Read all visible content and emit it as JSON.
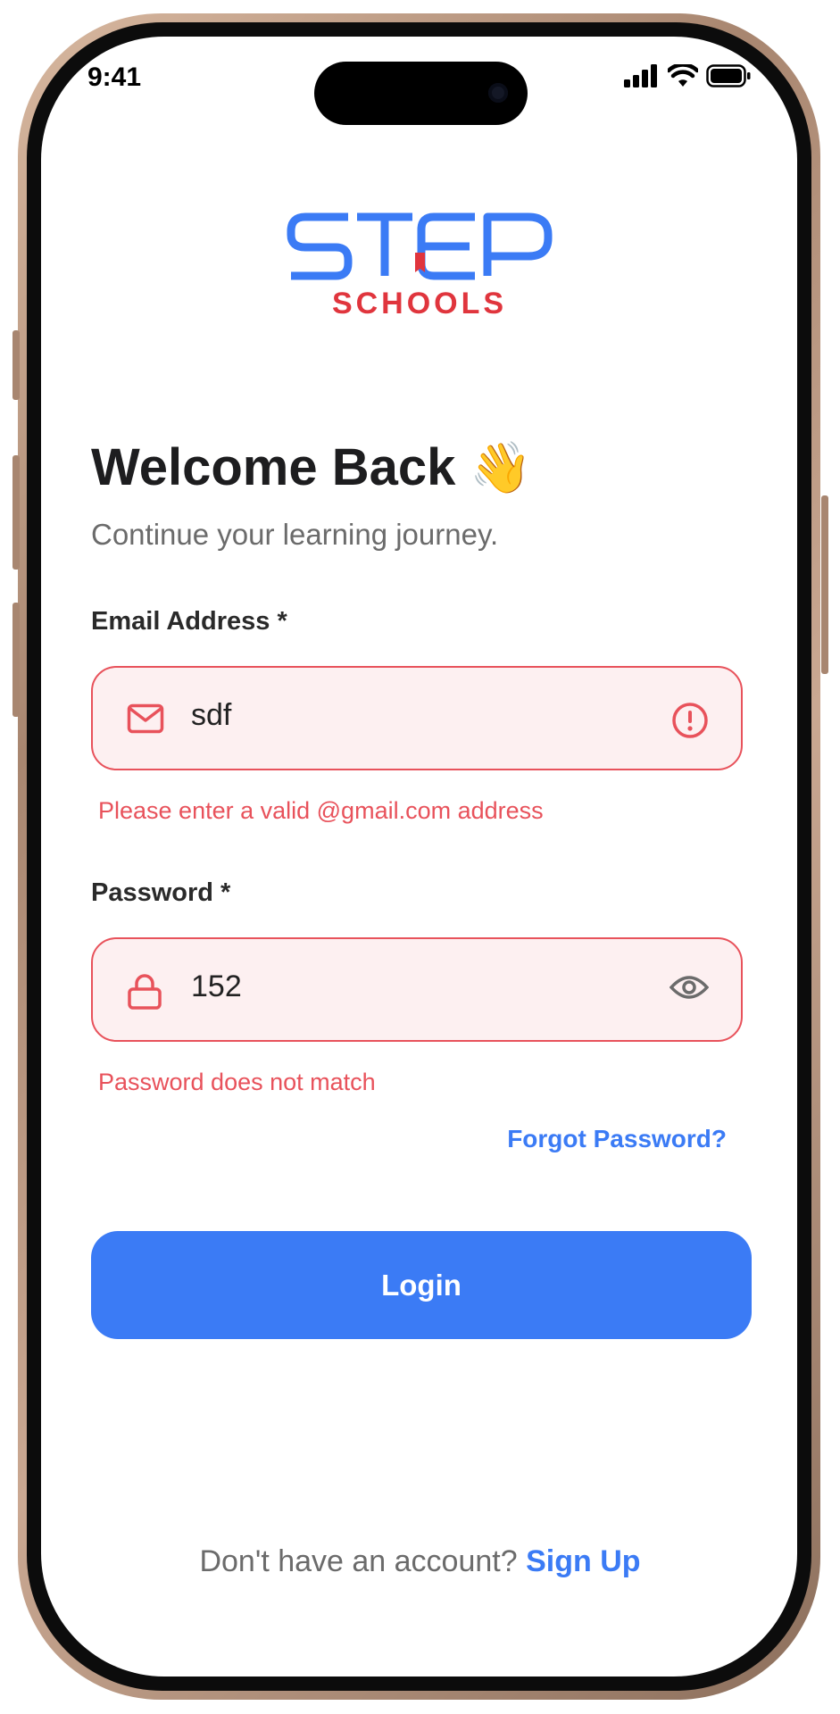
{
  "status_bar": {
    "time": "9:41"
  },
  "brand": {
    "logo_main": "STEP",
    "logo_sub": "SCHOOLS",
    "primary_color": "#3b7bf5",
    "accent_color": "#e0353d"
  },
  "header": {
    "title": "Welcome Back",
    "wave_emoji": "👋",
    "subtitle": "Continue your learning journey."
  },
  "email": {
    "label": "Email Address *",
    "value": "sdf",
    "error": "Please enter a valid @gmail.com address",
    "icon": "mail-icon",
    "status_icon": "alert-circle-icon"
  },
  "password": {
    "label": "Password *",
    "value": "152",
    "error": "Password does not match",
    "icon": "lock-icon",
    "toggle_icon": "eye-icon"
  },
  "forgot_password": "Forgot Password?",
  "login_button": "Login",
  "footer": {
    "prompt": "Don't have an account?",
    "signup": "Sign Up"
  },
  "colors": {
    "error": "#e8525b",
    "error_bg": "#fdf0f1",
    "text": "#1d1d1f",
    "muted": "#6b6b6b"
  }
}
